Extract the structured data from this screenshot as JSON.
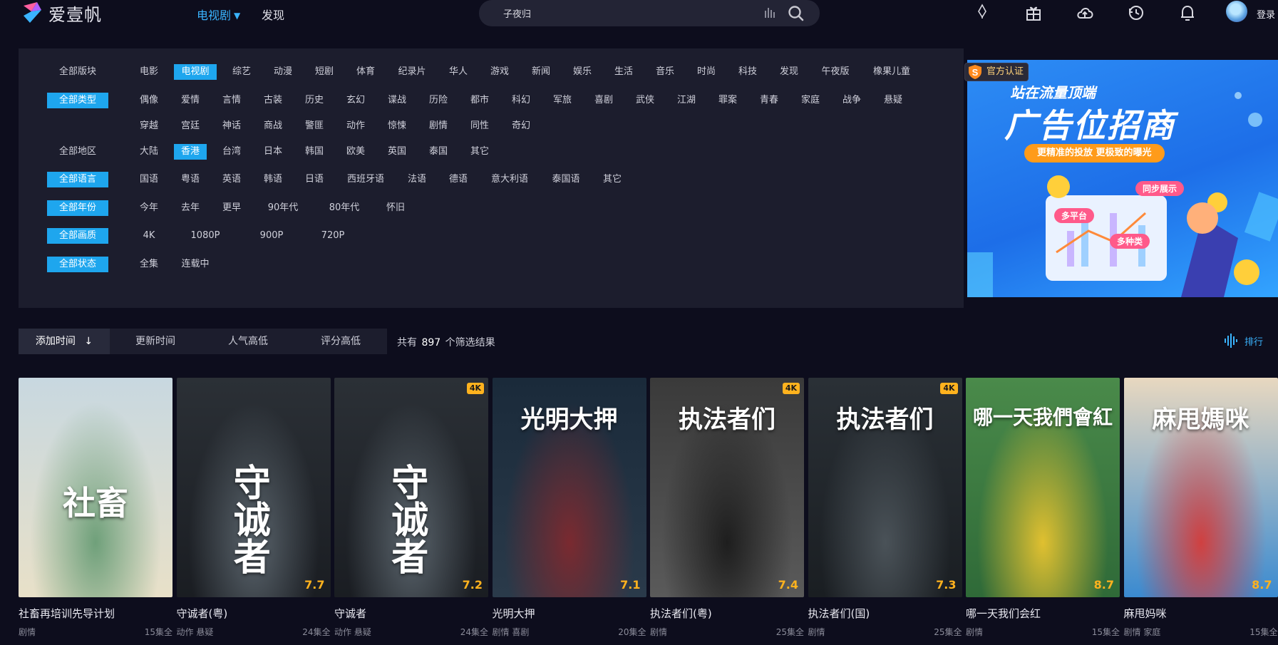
{
  "app": {
    "name": "爱壹帆"
  },
  "nav": {
    "tv_label": "电视剧",
    "discover_label": "发现"
  },
  "search": {
    "value": "子夜归"
  },
  "user": {
    "login_label": "登录"
  },
  "filters": {
    "rows": [
      {
        "category": "全部版块",
        "category_active": false,
        "options": [
          "电影",
          "电视剧",
          "综艺",
          "动漫",
          "短剧",
          "体育",
          "纪录片",
          "华人",
          "游戏",
          "新闻",
          "娱乐",
          "生活",
          "音乐",
          "时尚",
          "科技",
          "发现",
          "午夜版",
          "橡果儿童"
        ],
        "active_index": 1
      },
      {
        "category": "全部类型",
        "category_active": true,
        "options": [
          "偶像",
          "爱情",
          "言情",
          "古装",
          "历史",
          "玄幻",
          "谍战",
          "历险",
          "都市",
          "科幻",
          "军旅",
          "喜剧",
          "武侠",
          "江湖",
          "罪案",
          "青春",
          "家庭",
          "战争",
          "悬疑"
        ],
        "active_index": -1
      },
      {
        "category": "",
        "category_active": false,
        "options": [
          "穿越",
          "宫廷",
          "神话",
          "商战",
          "警匪",
          "动作",
          "惊悚",
          "剧情",
          "同性",
          "奇幻"
        ],
        "active_index": -1
      },
      {
        "category": "全部地区",
        "category_active": false,
        "options": [
          "大陆",
          "香港",
          "台湾",
          "日本",
          "韩国",
          "欧美",
          "英国",
          "泰国",
          "其它"
        ],
        "active_index": 1
      },
      {
        "category": "全部语言",
        "category_active": true,
        "options": [
          "国语",
          "粤语",
          "英语",
          "韩语",
          "日语",
          "西班牙语",
          "法语",
          "德语",
          "意大利语",
          "泰国语",
          "其它"
        ],
        "active_index": -1
      },
      {
        "category": "全部年份",
        "category_active": true,
        "options": [
          "今年",
          "去年",
          "更早",
          "90年代",
          "80年代",
          "怀旧"
        ],
        "active_index": -1
      },
      {
        "category": "全部画质",
        "category_active": true,
        "options": [
          "4K",
          "1080P",
          "900P",
          "720P"
        ],
        "active_index": -1
      },
      {
        "category": "全部状态",
        "category_active": true,
        "options": [
          "全集",
          "连载中"
        ],
        "active_index": -1
      }
    ]
  },
  "ad": {
    "badge": "官方认证",
    "headline_small": "站在流量顶端",
    "headline_big": "广告位招商",
    "tagline": "更精准的投放 更极致的曝光",
    "tag1": "多平台",
    "tag2": "多种类",
    "tag3": "同步展示"
  },
  "sort": {
    "tabs": [
      {
        "label": "添加时间",
        "arrow": "↓"
      },
      {
        "label": "更新时间"
      },
      {
        "label": "人气高低"
      },
      {
        "label": "评分高低"
      }
    ],
    "result_prefix": "共有",
    "result_count": "897",
    "result_suffix": "个筛选结果",
    "rank_label": "排行"
  },
  "shows": [
    {
      "title": "社畜再培训先导计划",
      "genres": "剧情",
      "episodes": "15集全",
      "score": "",
      "is4k": false,
      "poster_text": "社畜",
      "colors": [
        "#c8d8e0",
        "#6fa07a",
        "#e8e0c8"
      ]
    },
    {
      "title": "守诚者(粤)",
      "genres": "动作 悬疑",
      "episodes": "24集全",
      "score": "7.7",
      "is4k": false,
      "poster_text": "守诚者",
      "colors": [
        "#2b3036",
        "#5a646c",
        "#1a1d22"
      ]
    },
    {
      "title": "守诚者",
      "genres": "动作 悬疑",
      "episodes": "24集全",
      "score": "7.2",
      "is4k": true,
      "poster_text": "守诚者",
      "colors": [
        "#2b3036",
        "#5a646c",
        "#1a1d22"
      ]
    },
    {
      "title": "光明大押",
      "genres": "剧情 喜剧",
      "episodes": "20集全",
      "score": "7.1",
      "is4k": false,
      "poster_text": "光明大押",
      "colors": [
        "#1a2a3a",
        "#7a2a30",
        "#2a3a4a"
      ]
    },
    {
      "title": "执法者们(粤)",
      "genres": "剧情",
      "episodes": "25集全",
      "score": "7.4",
      "is4k": true,
      "poster_text": "执法者们",
      "colors": [
        "#3a3a3a",
        "#1e1e1e",
        "#5a5a5a"
      ]
    },
    {
      "title": "执法者们(国)",
      "genres": "剧情",
      "episodes": "25集全",
      "score": "7.3",
      "is4k": true,
      "poster_text": "执法者们",
      "colors": [
        "#2a3036",
        "#4a5258",
        "#1a1e22"
      ]
    },
    {
      "title": "哪一天我们会红",
      "genres": "剧情",
      "episodes": "15集全",
      "score": "8.7",
      "is4k": false,
      "poster_text": "哪一天我們會紅",
      "colors": [
        "#4a8a4a",
        "#e0c030",
        "#2f6a38"
      ]
    },
    {
      "title": "麻甩妈咪",
      "genres": "剧情 家庭",
      "episodes": "15集全",
      "score": "8.7",
      "is4k": false,
      "poster_text": "麻甩媽咪",
      "colors": [
        "#e8d8c0",
        "#d04040",
        "#3a8ad0"
      ]
    }
  ],
  "colors": {
    "accent": "#1ea6ee",
    "score": "#ffb21e",
    "panel": "#1c1d2d",
    "background": "#0d0d1d"
  }
}
